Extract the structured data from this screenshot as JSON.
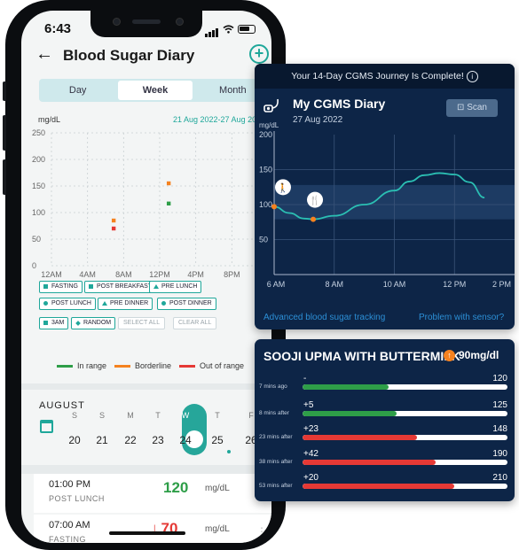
{
  "status_bar": {
    "time": "6:43"
  },
  "header": {
    "title": "Blood Sugar Diary",
    "back_icon": "arrow-left-icon",
    "add_icon": "plus-circle-icon"
  },
  "period_tabs": [
    {
      "label": "Day",
      "selected": false
    },
    {
      "label": "Week",
      "selected": true
    },
    {
      "label": "Month",
      "selected": false
    }
  ],
  "week_chart": {
    "unit": "mg/dL",
    "date_range": "21 Aug 2022-27 Aug 2022",
    "y_ticks": [
      "250",
      "200",
      "150",
      "100",
      "50",
      "0"
    ],
    "x_ticks": [
      "12AM",
      "4AM",
      "8AM",
      "12PM",
      "4PM",
      "8PM"
    ]
  },
  "chart_data": {
    "type": "scatter",
    "x": [
      6.9,
      6.9,
      13.0,
      13.0
    ],
    "y": [
      85,
      70,
      155,
      117
    ],
    "point_status": [
      "Borderline",
      "Out of range",
      "Borderline",
      "In range"
    ],
    "ylim": [
      0,
      250
    ],
    "xlim": [
      0,
      24
    ],
    "grid": true
  },
  "filters": [
    {
      "label": "FASTING",
      "mark": "square",
      "active": true
    },
    {
      "label": "POST BREAKFAST",
      "mark": "square",
      "active": true
    },
    {
      "label": "PRE LUNCH",
      "mark": "triangle",
      "active": true
    },
    {
      "label": "POST LUNCH",
      "mark": "circle",
      "active": true
    },
    {
      "label": "PRE DINNER",
      "mark": "triangle",
      "active": true
    },
    {
      "label": "POST DINNER",
      "mark": "circle",
      "active": true
    },
    {
      "label": "3AM",
      "mark": "square",
      "active": true
    },
    {
      "label": "RANDOM",
      "mark": "diamond",
      "active": true
    },
    {
      "label": "SELECT ALL",
      "mark": "none",
      "active": false
    },
    {
      "label": "CLEAR ALL",
      "mark": "none",
      "active": false
    }
  ],
  "legend": [
    {
      "label": "In range",
      "color": "#2e9e48"
    },
    {
      "label": "Borderline",
      "color": "#f5821f"
    },
    {
      "label": "Out of range",
      "color": "#e53935"
    }
  ],
  "calendar": {
    "month": "AUGUST",
    "days": [
      {
        "wd": "S",
        "date": "20",
        "selected": false
      },
      {
        "wd": "S",
        "date": "21",
        "selected": false
      },
      {
        "wd": "M",
        "date": "22",
        "selected": false
      },
      {
        "wd": "T",
        "date": "23",
        "selected": false
      },
      {
        "wd": "W",
        "date": "24",
        "selected": true
      },
      {
        "wd": "T",
        "date": "25",
        "selected": false
      },
      {
        "wd": "F",
        "date": "26",
        "selected": false
      }
    ]
  },
  "readings": [
    {
      "time": "01:00 PM",
      "label": "POST LUNCH",
      "value": "120",
      "unit": "mg/dL",
      "arrow": "",
      "color": "#2e9e48"
    },
    {
      "time": "07:00 AM",
      "label": "FASTING",
      "value": "70",
      "unit": "mg/dL",
      "arrow": "↓",
      "color": "#e53935"
    }
  ],
  "cgms": {
    "banner": "Your 14-Day CGMS Journey Is Complete!",
    "info_icon": "info-circle-icon",
    "title": "My CGMS Diary",
    "date": "27 Aug 2022",
    "scan_label": "Scan",
    "scan_icon": "scan-icon",
    "unit": "mg/dL",
    "y_ticks": [
      "200",
      "150",
      "100",
      "50"
    ],
    "x_ticks": [
      "6 AM",
      "8 AM",
      "10 AM",
      "12 PM",
      "2 PM"
    ],
    "target_range": [
      79,
      128
    ],
    "curve": {
      "x": [
        6.0,
        6.5,
        7.0,
        7.3,
        8.0,
        9.0,
        10.0,
        10.5,
        11.0,
        11.5,
        12.0,
        12.5,
        13.0
      ],
      "y": [
        97,
        88,
        80,
        79,
        84,
        100,
        120,
        133,
        142,
        145,
        143,
        132,
        110
      ]
    },
    "markers": [
      {
        "x": 6.0,
        "y": 97,
        "icon": "walking-icon"
      },
      {
        "x": 7.3,
        "y": 79,
        "icon": "fork-knife-icon"
      }
    ],
    "links": [
      "Advanced blood sugar tracking",
      "Problem with sensor?"
    ]
  },
  "meal": {
    "title": "SOOJI UPMA WITH BUTTERMILK",
    "badge_value": "90mg/dl",
    "badge_icon": "arrow-up-circle-icon",
    "rows": [
      {
        "label": "7 mins ago",
        "delta": "-",
        "value": "120",
        "fill": 0.42,
        "color": "#2e9e48"
      },
      {
        "label": "8 mins after",
        "delta": "+5",
        "value": "125",
        "fill": 0.46,
        "color": "#2e9e48"
      },
      {
        "label": "23 mins after",
        "delta": "+23",
        "value": "148",
        "fill": 0.56,
        "color": "#e53935"
      },
      {
        "label": "38 mins after",
        "delta": "+42",
        "value": "190",
        "fill": 0.65,
        "color": "#e53935"
      },
      {
        "label": "53 mins after",
        "delta": "+20",
        "value": "210",
        "fill": 0.74,
        "color": "#e53935"
      }
    ]
  }
}
